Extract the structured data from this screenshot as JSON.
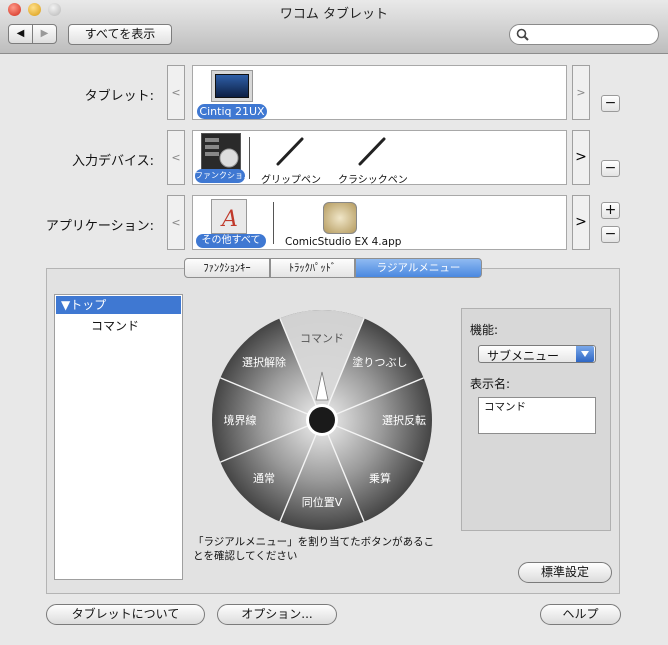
{
  "window": {
    "title": "ワコム タブレット"
  },
  "toolbar": {
    "back": "◀",
    "forward": "▶",
    "show_all": "すべてを表示",
    "search_placeholder": ""
  },
  "rows": {
    "tablet": {
      "label": "タブレット:",
      "items": [
        {
          "label": "Cintiq 21UX",
          "selected": true
        }
      ]
    },
    "input": {
      "label": "入力デバイス:",
      "items": [
        {
          "label": "ファンクション",
          "selected": true
        },
        {
          "label": "グリップペン",
          "selected": false
        },
        {
          "label": "クラシックペン",
          "selected": false
        }
      ]
    },
    "app": {
      "label": "アプリケーション:",
      "items": [
        {
          "label": "その他すべて",
          "selected": true
        },
        {
          "label": "ComicStudio EX 4.app",
          "selected": false
        }
      ]
    },
    "nav_prev": "<",
    "nav_next": ">",
    "add": "+",
    "remove": "−"
  },
  "tabs": [
    {
      "label": "ﾌｧﾝｸｼｮﾝｷｰ",
      "selected": false
    },
    {
      "label": "ﾄﾗｯｸﾊﾟｯﾄﾞ",
      "selected": false
    },
    {
      "label": "ラジアルメニュー",
      "selected": true
    }
  ],
  "tree": {
    "root": "▼トップ",
    "child": "コマンド"
  },
  "radial": {
    "segments": [
      "コマンド",
      "塗りつぶし",
      "選択反転",
      "乗算",
      "同位置V",
      "通常",
      "境界線",
      "選択解除"
    ],
    "note_line1": "「ラジアルメニュー」を割り当てたボタンがあるこ",
    "note_line2": "とを確認してください"
  },
  "settings": {
    "function_label": "機能:",
    "function_value": "サブメニュー",
    "name_label": "表示名:",
    "name_value": "コマンド",
    "default_button": "標準設定"
  },
  "footer": {
    "about": "タブレットについて",
    "options": "オプション...",
    "help": "ヘルプ"
  },
  "colors": {
    "selection": "#3f78d2",
    "window_bg": "#e8e8e8"
  }
}
